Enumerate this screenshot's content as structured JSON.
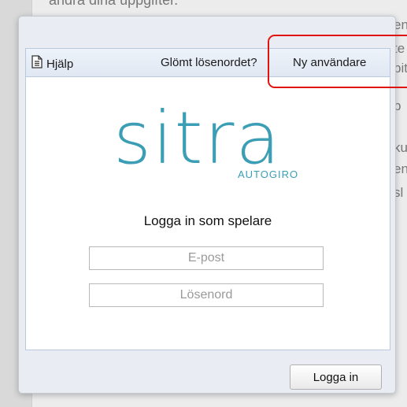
{
  "background": {
    "top_text": "ändra dina uppgifter.",
    "fragments": [
      "en",
      "te",
      "pit",
      "p",
      "ku",
      "en",
      "sl"
    ]
  },
  "toolbar": {
    "help_label": "Hjälp",
    "forgot_label": "Glömt lösenordet?",
    "new_user_label": "Ny användare"
  },
  "logo": {
    "word": "sitra",
    "sub": "AUTOGIRO"
  },
  "login": {
    "heading": "Logga in som spelare",
    "email_placeholder": "E-post",
    "password_placeholder": "Lösenord",
    "submit_label": "Logga in"
  },
  "colors": {
    "brand": "#3b9eb5",
    "highlight": "#e0140c"
  }
}
